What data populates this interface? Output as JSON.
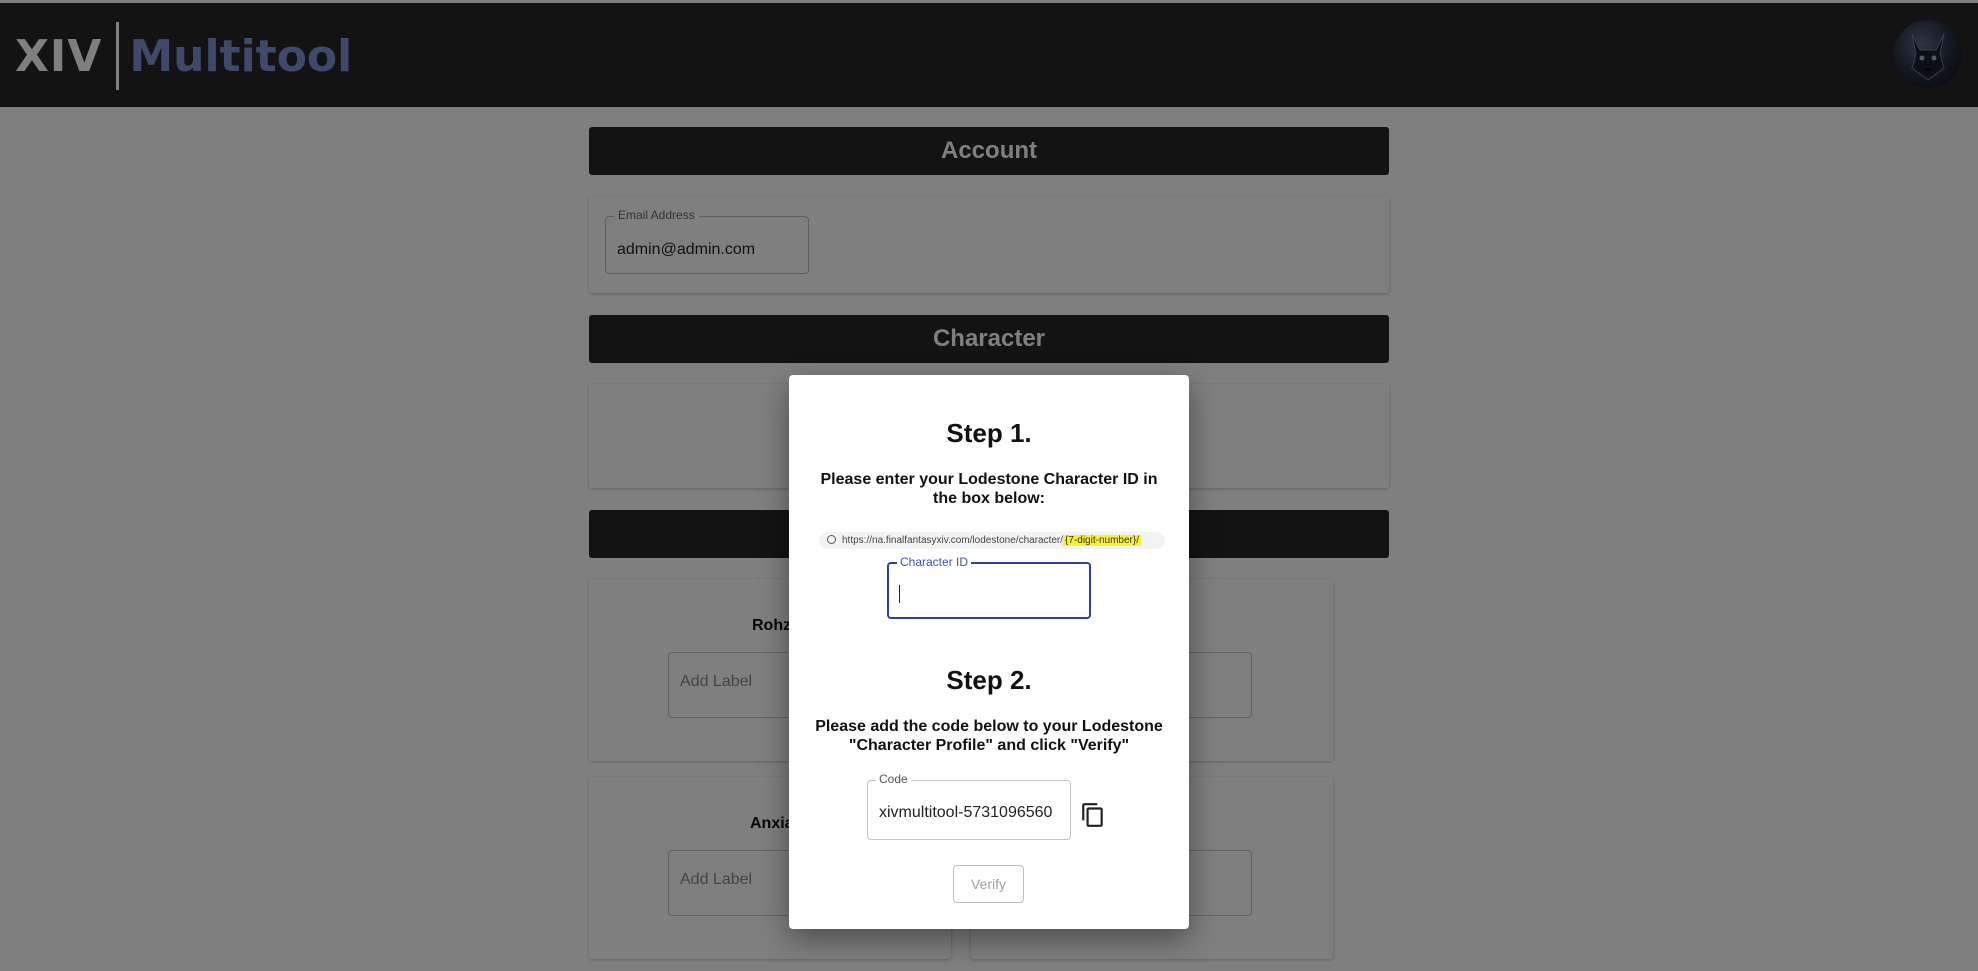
{
  "app_bar": {
    "logo_primary": "XIV",
    "logo_secondary": "Multitool",
    "logo_secondary_color": "#7d92d6",
    "avatar_icon": "wolf-avatar"
  },
  "account": {
    "header": "Account",
    "email_label": "Email Address",
    "email_value": "admin@admin.com"
  },
  "character": {
    "header": "Character"
  },
  "characters": [
    {
      "name": "Rohz",
      "label_placeholder": "Add Label"
    },
    {
      "name": "Anxia",
      "label_placeholder": "Add Label"
    }
  ],
  "dialog": {
    "step1_title": "Step 1.",
    "step1_instruction": "Please enter your Lodestone Character ID in the box below:",
    "url_prefix": "https://na.finalfantasyxiv.com/lodestone/character/",
    "url_placeholder": "{7-digit-number}/",
    "character_id_label": "Character ID",
    "character_id_value": "",
    "step2_title": "Step 2.",
    "step2_instruction": "Please add the code below to your Lodestone \"Character Profile\" and click \"Verify\"",
    "code_label": "Code",
    "code_value": "xivmultitool-5731096560",
    "verify_label": "Verify"
  },
  "colors": {
    "app_bar": "#272727",
    "focus_accent": "#2f3f9e",
    "url_highlight": "#f8f230"
  }
}
